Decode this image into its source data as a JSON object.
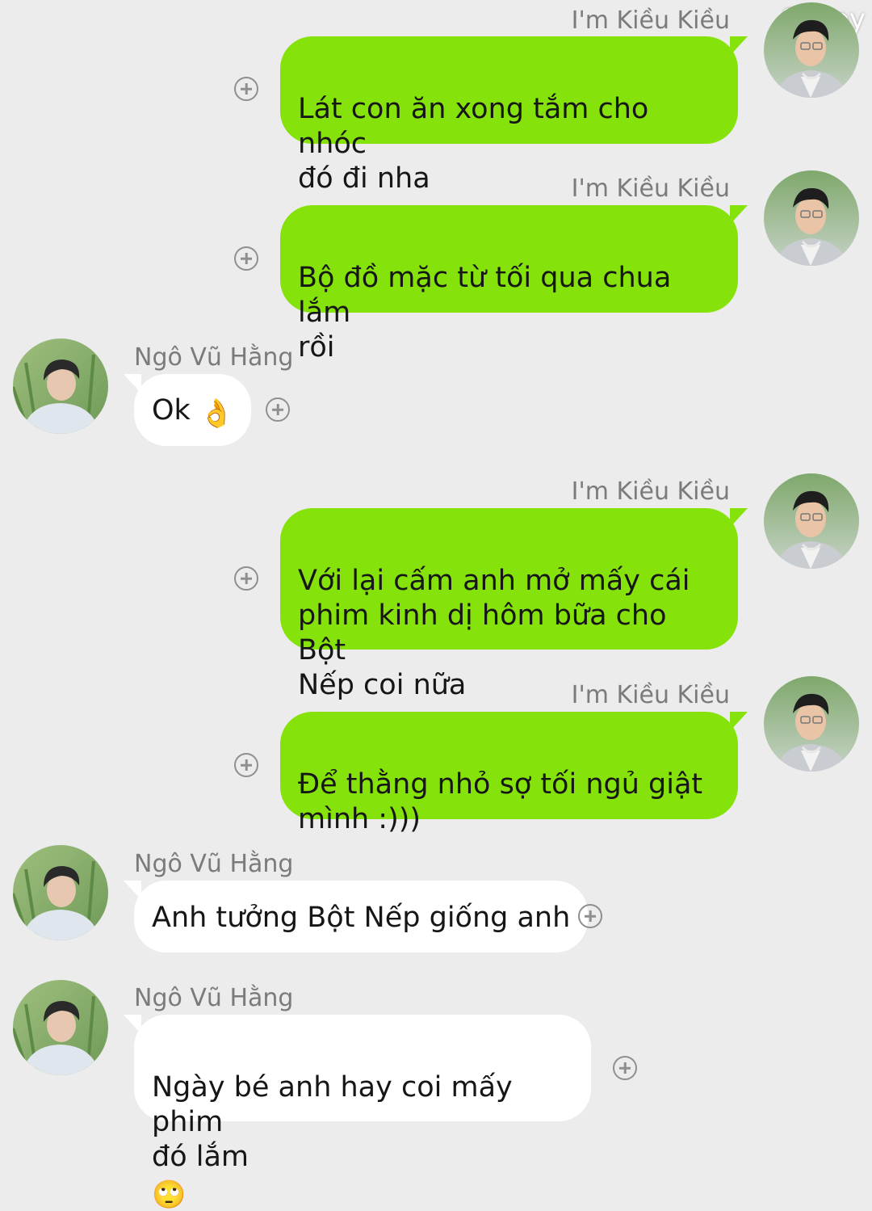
{
  "watermark": "98 joy",
  "messages": [
    {
      "sender": "I'm Kiều Kiều",
      "text": "Lát con ăn xong tắm cho nhóc\nđó đi nha",
      "emoji": ""
    },
    {
      "sender": "I'm Kiều Kiều",
      "text": "Bộ đồ mặc từ tối qua chua lắm\nrồi",
      "emoji": ""
    },
    {
      "sender": "Ngô Vũ Hằng",
      "text": "Ok",
      "emoji": "👌"
    },
    {
      "sender": "I'm Kiều Kiều",
      "text": "Với lại cấm anh mở mấy cái\nphim kinh dị hôm bữa cho Bột\nNếp coi nữa",
      "emoji": ""
    },
    {
      "sender": "I'm Kiều Kiều",
      "text": "Để thằng nhỏ sợ tối ngủ giật\nmình :)))",
      "emoji": ""
    },
    {
      "sender": "Ngô Vũ Hằng",
      "text": "Anh tưởng Bột Nếp giống anh",
      "emoji": ""
    },
    {
      "sender": "Ngô Vũ Hằng",
      "text": "Ngày bé anh hay coi mấy phim\nđó lắm",
      "emoji": "🙄"
    }
  ],
  "colors": {
    "background": "#ececec",
    "outgoing_bubble": "#86e20b",
    "incoming_bubble": "#ffffff",
    "sender_name": "#7b7b7b"
  },
  "icons": {
    "add_reaction": "plus-circle-icon"
  }
}
